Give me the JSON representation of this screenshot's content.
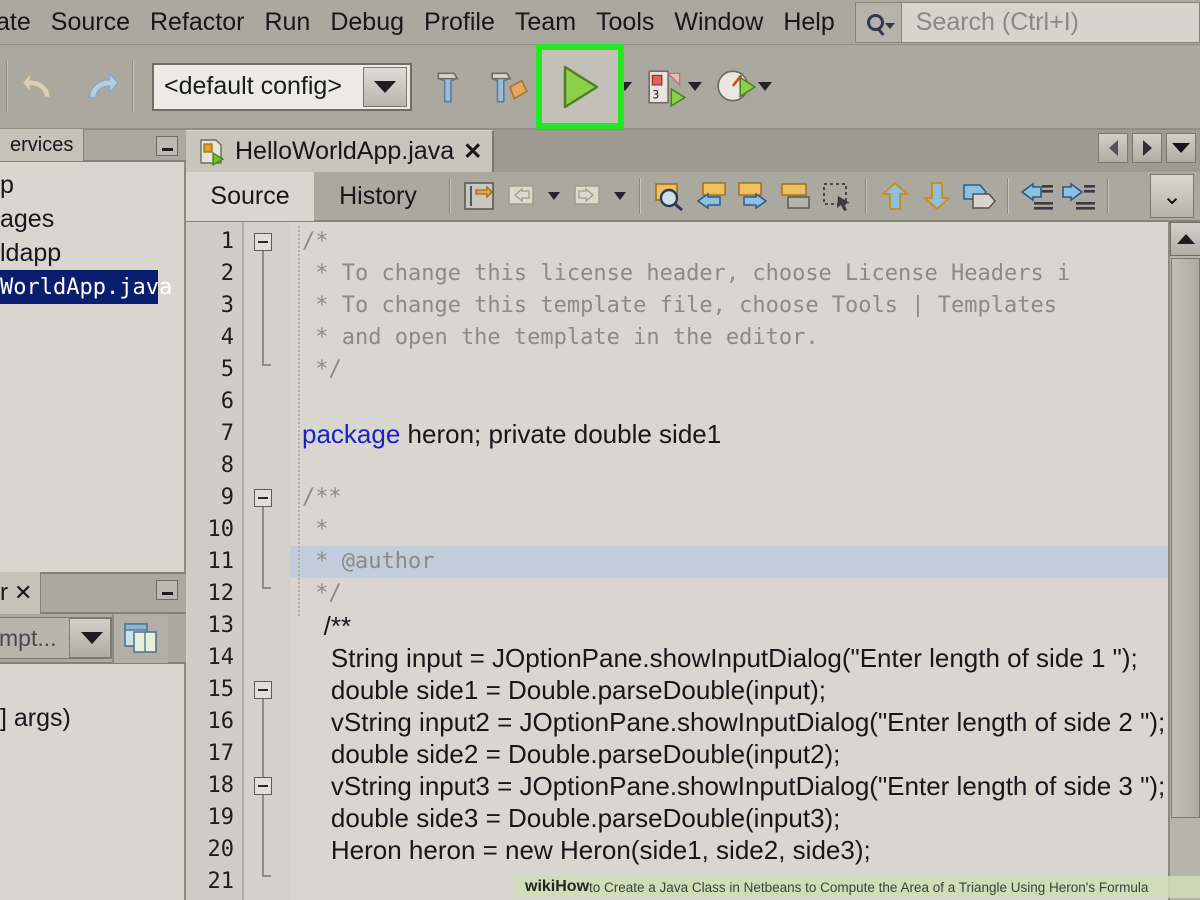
{
  "menubar": {
    "items": [
      "ate",
      "Source",
      "Refactor",
      "Run",
      "Debug",
      "Profile",
      "Team",
      "Tools",
      "Window",
      "Help"
    ],
    "search_placeholder": "Search (Ctrl+I)",
    "search_value": ""
  },
  "toolbar": {
    "undo_label": "undo",
    "redo_label": "redo",
    "config_value": "<default config>",
    "build_label": "build",
    "clean_build_label": "clean-and-build",
    "run_label": "run",
    "debug_label": "debug",
    "profile_label": "profile",
    "highlight_color": "#22e822"
  },
  "sidebar": {
    "top_panel": {
      "tab_label": "ervices",
      "minimize_label": "minimize",
      "tree_items": [
        {
          "label": "p",
          "selected": false
        },
        {
          "label": "ages",
          "selected": false
        },
        {
          "label": "ldapp",
          "selected": false
        },
        {
          "label": "WorldApp.java",
          "selected": true
        }
      ]
    },
    "bottom_panel": {
      "tab_label": "r",
      "close_label": "✕",
      "minimize_label": "minimize",
      "combo_value": "mpt...",
      "tool_icon": "layout-icon",
      "body_text": "] args)"
    }
  },
  "editor": {
    "tab": {
      "filename": "HelloWorldApp.java",
      "close_label": "✕",
      "nav_prev": "previous-tab",
      "nav_next": "next-tab",
      "nav_list": "tab-list"
    },
    "view_tabs": [
      {
        "label": "Source",
        "active": true
      },
      {
        "label": "History",
        "active": false
      }
    ],
    "buttons": [
      "last-edit-icon",
      "back-icon",
      "forward-icon",
      "find-selection-icon",
      "previous-bookmark-icon",
      "next-bookmark-icon",
      "toggle-bookmark-icon",
      "rectangular-selection-icon",
      "shift-line-up-icon",
      "shift-line-down-icon",
      "comment-icon",
      "shift-left-icon",
      "shift-right-icon"
    ],
    "expand_label": "⌄"
  },
  "code": {
    "lines": [
      {
        "n": "1",
        "style": "mono",
        "text": "/*",
        "fold": "start"
      },
      {
        "n": "2",
        "style": "mono",
        "text": " * To change this license header, choose License Headers i"
      },
      {
        "n": "3",
        "style": "mono",
        "text": " * To change this template file, choose Tools | Templates"
      },
      {
        "n": "4",
        "style": "mono",
        "text": " * and open the template in the editor."
      },
      {
        "n": "5",
        "style": "mono",
        "text": " */",
        "fold": "end"
      },
      {
        "n": "6",
        "style": "mono",
        "text": ""
      },
      {
        "n": "7",
        "style": "code",
        "keyword": "package",
        "text": " heron; private double side1"
      },
      {
        "n": "8",
        "style": "mono",
        "text": ""
      },
      {
        "n": "9",
        "style": "mono",
        "text": "/**",
        "fold": "start"
      },
      {
        "n": "10",
        "style": "mono",
        "text": " *"
      },
      {
        "n": "11",
        "style": "mono",
        "text": " * @author",
        "highlight": true
      },
      {
        "n": "12",
        "style": "mono",
        "text": " */",
        "fold": "end"
      },
      {
        "n": "13",
        "style": "code",
        "text": "   /**"
      },
      {
        "n": "14",
        "style": "code",
        "text": "    String input = JOptionPane.showInputDialog(\"Enter length of side 1 \");"
      },
      {
        "n": "15",
        "style": "code",
        "text": "    double side1 = Double.parseDouble(input);",
        "fold": "start"
      },
      {
        "n": "16",
        "style": "code",
        "text": "    vString input2 = JOptionPane.showInputDialog(\"Enter length of side 2 \");"
      },
      {
        "n": "17",
        "style": "code",
        "text": "    double side2 = Double.parseDouble(input2);",
        "fold": "end"
      },
      {
        "n": "18",
        "style": "code",
        "text": "    vString input3 = JOptionPane.showInputDialog(\"Enter length of side 3 \");",
        "fold": "start"
      },
      {
        "n": "19",
        "style": "code",
        "text": "    double side3 = Double.parseDouble(input3);"
      },
      {
        "n": "20",
        "style": "code",
        "text": "    Heron heron = new Heron(side1, side2, side3);",
        "fold": "end"
      },
      {
        "n": "21",
        "style": "code",
        "text": ""
      }
    ]
  },
  "watermark": {
    "brand_wiki": "wiki",
    "brand_how": "How",
    "text": " to Create a Java Class in Netbeans to Compute the Area of a Triangle Using Heron's Formula"
  }
}
